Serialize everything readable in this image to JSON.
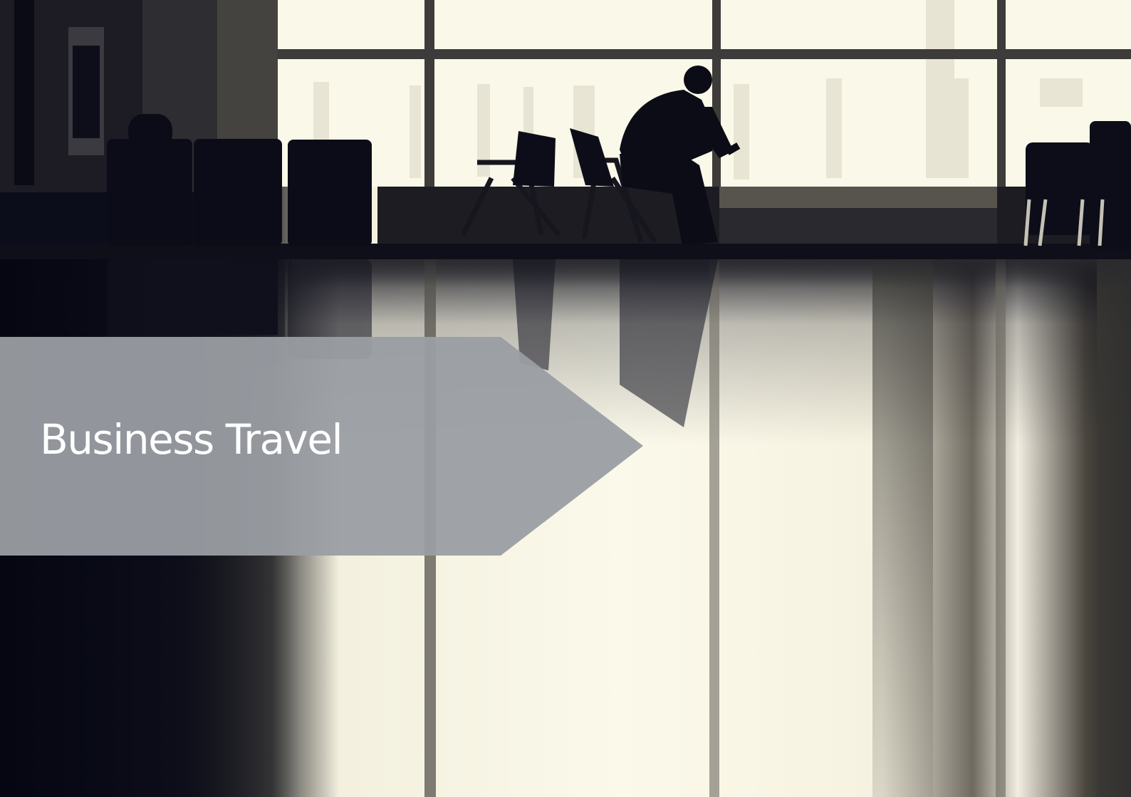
{
  "banner": {
    "title": "Business Travel",
    "color": "#9a9ea3"
  },
  "photo": {
    "subject": "silhouette-traveller-in-airport-lounge",
    "palette": {
      "shadow": "#0a0b16",
      "light": "#fbf9ea",
      "midtone": "#6b6860"
    }
  }
}
